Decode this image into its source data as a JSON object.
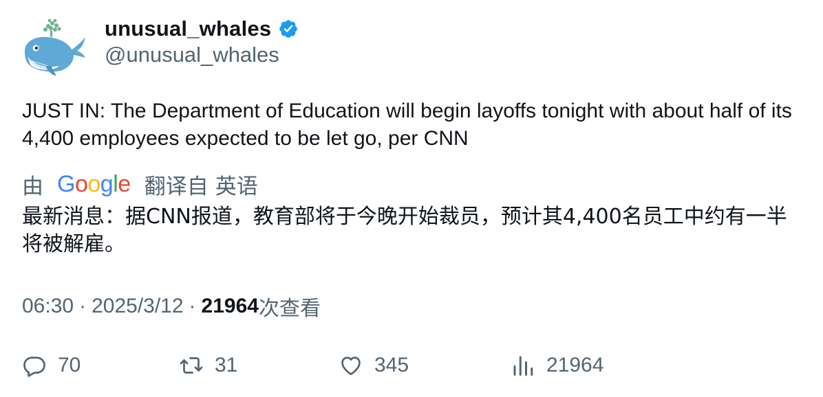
{
  "author": {
    "display_name": "unusual_whales",
    "handle": "@unusual_whales",
    "verified": true,
    "avatar_icon": "whale-icon"
  },
  "tweet": {
    "text": "JUST IN: The Department of Education will begin layoffs tonight with about half of its 4,400 employees expected to be let go, per CNN"
  },
  "translation": {
    "by_label": "由",
    "provider_letters": [
      "G",
      "o",
      "o",
      "g",
      "l",
      "e"
    ],
    "translated_from_label": "翻译自",
    "language": "英语",
    "text": "最新消息：据CNN报道，教育部将于今晚开始裁员，预计其4,400名员工中约有一半将被解雇。"
  },
  "meta": {
    "time": "06:30",
    "separator": "·",
    "date": "2025/3/12",
    "views_count": "21964",
    "views_label": "次查看"
  },
  "actions": {
    "replies": "70",
    "retweets": "31",
    "likes": "345",
    "views": "21964"
  },
  "colors": {
    "text": "#0f1419",
    "secondary": "#536471",
    "verified_blue": "#1d9bf0",
    "google_blue": "#4285F4",
    "google_red": "#EA4335",
    "google_yellow": "#FBBC05",
    "google_green": "#34A853"
  }
}
